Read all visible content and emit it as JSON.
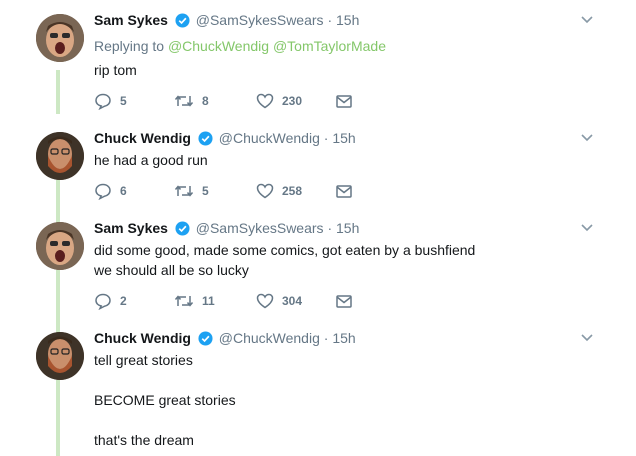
{
  "tweets": [
    {
      "name": "Sam Sykes",
      "handle": "@SamSykesSwears",
      "time": "15h",
      "replying_prefix": "Replying to",
      "replying_mentions": [
        "@ChuckWendig",
        "@TomTaylorMade"
      ],
      "lines": [
        "rip tom"
      ],
      "replies": "5",
      "retweets": "8",
      "likes": "230"
    },
    {
      "name": "Chuck Wendig",
      "handle": "@ChuckWendig",
      "time": "15h",
      "lines": [
        "he had a good run"
      ],
      "replies": "6",
      "retweets": "5",
      "likes": "258"
    },
    {
      "name": "Sam Sykes",
      "handle": "@SamSykesSwears",
      "time": "15h",
      "lines": [
        "did some good, made some comics, got eaten by a bushfiend",
        "we should all be so lucky"
      ],
      "replies": "2",
      "retweets": "11",
      "likes": "304"
    },
    {
      "name": "Chuck Wendig",
      "handle": "@ChuckWendig",
      "time": "15h",
      "lines": [
        "tell great stories",
        "BECOME great stories",
        "that's the dream"
      ],
      "replies": "",
      "retweets": "",
      "likes": ""
    }
  ],
  "dot": "·",
  "colors": {
    "thread_line": "#cde8c4",
    "mention": "#84c76a",
    "verified": "#1da1f2",
    "secondary_text": "#657786"
  },
  "icons": [
    "verified-badge-icon",
    "chevron-down-icon",
    "reply-icon",
    "retweet-icon",
    "like-icon",
    "direct-message-icon"
  ]
}
